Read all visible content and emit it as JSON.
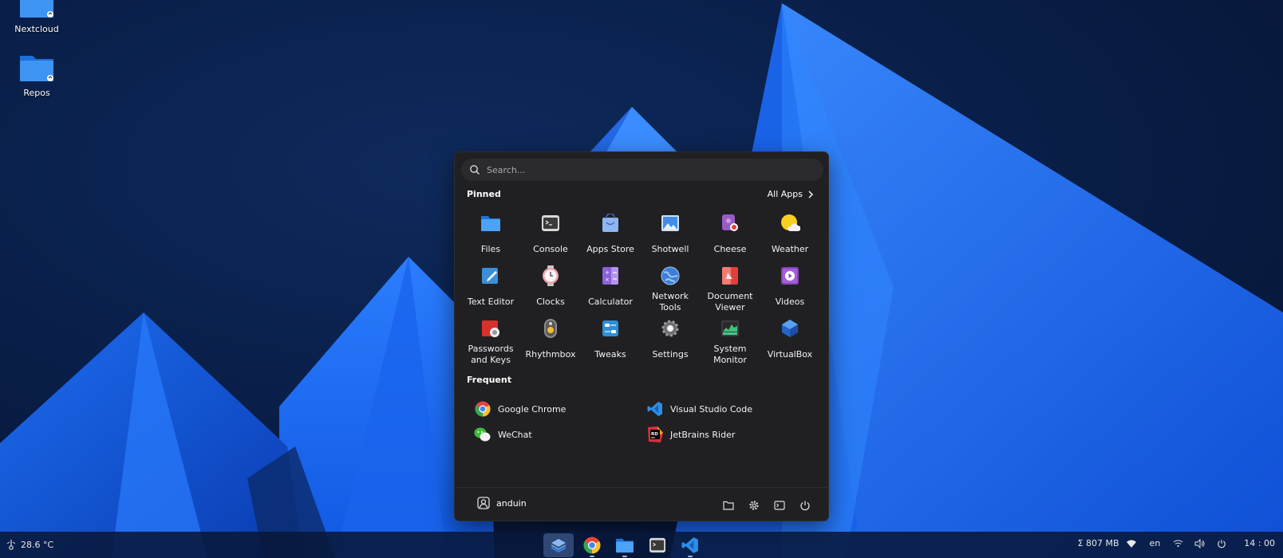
{
  "desktop": {
    "icons": [
      {
        "label": "Nextcloud"
      },
      {
        "label": "Repos"
      }
    ]
  },
  "menu": {
    "search_placeholder": "Search...",
    "pinned_title": "Pinned",
    "all_apps_label": "All Apps",
    "pinned": [
      {
        "name": "Files",
        "icon": "folder-icon"
      },
      {
        "name": "Console",
        "icon": "terminal-icon"
      },
      {
        "name": "Apps Store",
        "icon": "store-bag-icon"
      },
      {
        "name": "Shotwell",
        "icon": "photo-icon"
      },
      {
        "name": "Cheese",
        "icon": "camera-icon"
      },
      {
        "name": "Weather",
        "icon": "sun-cloud-icon"
      },
      {
        "name": "Text Editor",
        "icon": "text-editor-icon"
      },
      {
        "name": "Clocks",
        "icon": "clock-icon"
      },
      {
        "name": "Calculator",
        "icon": "calculator-icon"
      },
      {
        "name": "Network Tools",
        "icon": "globe-icon"
      },
      {
        "name": "Document Viewer",
        "icon": "document-icon"
      },
      {
        "name": "Videos",
        "icon": "video-play-icon"
      },
      {
        "name": "Passwords and Keys",
        "icon": "keyring-icon"
      },
      {
        "name": "Rhythmbox",
        "icon": "speaker-icon"
      },
      {
        "name": "Tweaks",
        "icon": "tweaks-icon"
      },
      {
        "name": "Settings",
        "icon": "gear-icon"
      },
      {
        "name": "System Monitor",
        "icon": "monitor-chart-icon"
      },
      {
        "name": "VirtualBox",
        "icon": "cube-icon"
      }
    ],
    "frequent_title": "Frequent",
    "frequent": [
      {
        "name": "Google Chrome",
        "icon": "chrome-icon"
      },
      {
        "name": "Visual Studio Code",
        "icon": "vscode-icon"
      },
      {
        "name": "WeChat",
        "icon": "wechat-icon"
      },
      {
        "name": "JetBrains Rider",
        "icon": "rider-icon"
      }
    ],
    "user_name": "anduin"
  },
  "taskbar": {
    "weather_temp": "28.6 °C",
    "memory": "Σ 807 MB",
    "language": "en",
    "clock": "14 : 00"
  }
}
